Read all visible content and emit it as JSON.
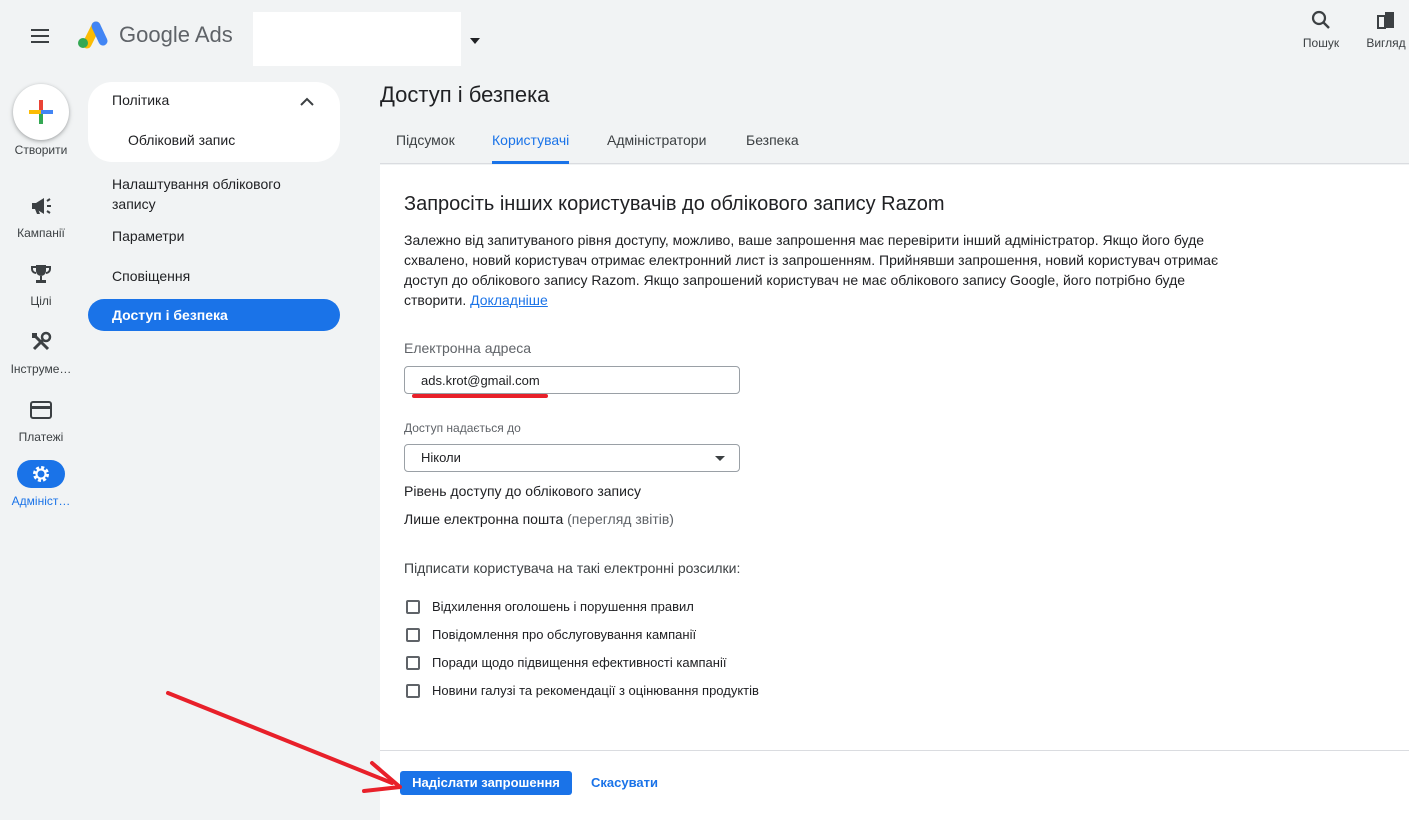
{
  "header": {
    "brand": "Google Ads",
    "search_label": "Пошук",
    "view_label": "Вигляд"
  },
  "rail": {
    "create_label": "Створити",
    "items": [
      {
        "label": "Кампанії",
        "icon": "megaphone-icon"
      },
      {
        "label": "Цілі",
        "icon": "trophy-icon"
      },
      {
        "label": "Інструме…",
        "icon": "tools-icon"
      },
      {
        "label": "Платежі",
        "icon": "credit-card-icon"
      },
      {
        "label": "Адмініст…",
        "icon": "gear-icon",
        "active": true
      }
    ]
  },
  "subnav": {
    "group_label": "Політика",
    "group_child": "Обліковий запис",
    "items": [
      "Налаштування облікового запису",
      "Параметри",
      "Сповіщення"
    ],
    "active": "Доступ і безпека"
  },
  "page": {
    "title": "Доступ і безпека",
    "tabs": [
      "Підсумок",
      "Користувачі",
      "Адміністратори",
      "Безпека"
    ],
    "active_tab": "Користувачі"
  },
  "invite": {
    "title": "Запросіть інших користувачів до облікового запису Razom",
    "description": "Залежно від запитуваного рівня доступу, можливо, ваше запрошення має перевірити інший адміністратор. Якщо його буде схвалено, новий користувач отримає електронний лист із запрошенням. Прийнявши запрошення, новий користувач отримає доступ до облікового запису Razom. Якщо запрошений користувач не має облікового запису Google, його потрібно буде створити.",
    "learn_more": "Докладніше",
    "email_label": "Електронна адреса",
    "email_value": "ads.krot@gmail.com",
    "expire_label": "Доступ надається до",
    "expire_value": "Ніколи",
    "level_label": "Рівень доступу до облікового запису",
    "level_value": "Лише електронна пошта",
    "level_note": "(перегляд звітів)",
    "subscribe_label": "Підписати користувача на такі електронні розсилки:",
    "checkboxes": [
      "Відхилення оголошень і порушення правил",
      "Повідомлення про обслуговування кампанії",
      "Поради щодо підвищення ефективності кампанії",
      "Новини галузі та рекомендації з оцінювання продуктів"
    ],
    "send_label": "Надіслати запрошення",
    "cancel_label": "Скасувати"
  },
  "colors": {
    "accent": "#1a73e8",
    "annotation": "#e8202a"
  }
}
